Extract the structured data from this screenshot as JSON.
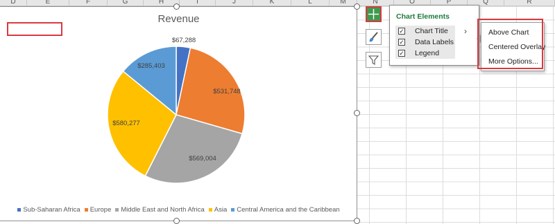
{
  "columns": [
    "D",
    "E",
    "F",
    "G",
    "H",
    "I",
    "J",
    "K",
    "L",
    "M",
    "N",
    "O",
    "P",
    "Q",
    "R"
  ],
  "chart": {
    "title": "Revenue",
    "data_labels": [
      "$67,288",
      "$531,748",
      "$569,004",
      "$580,277",
      "$285,403"
    ],
    "legend": [
      "Sub-Saharan Africa",
      "Europe",
      "Middle East and North Africa",
      "Asia",
      "Central America and the Caribbean"
    ]
  },
  "chart_data": {
    "type": "pie",
    "title": "Revenue",
    "categories": [
      "Sub-Saharan Africa",
      "Europe",
      "Middle East and North Africa",
      "Asia",
      "Central America and the Caribbean"
    ],
    "values": [
      67288,
      531748,
      569004,
      580277,
      285403
    ],
    "colors": [
      "#4472c4",
      "#ed7d31",
      "#a5a5a5",
      "#ffc000",
      "#5b9bd5"
    ],
    "legend_position": "bottom"
  },
  "side_buttons": [
    {
      "name": "chart-elements-icon"
    },
    {
      "name": "chart-styles-icon"
    },
    {
      "name": "chart-filters-icon"
    }
  ],
  "chart_elements_popup": {
    "heading": "Chart Elements",
    "items": [
      {
        "label": "Chart Title",
        "checked": true
      },
      {
        "label": "Data Labels",
        "checked": true
      },
      {
        "label": "Legend",
        "checked": true
      }
    ]
  },
  "chart_title_submenu": {
    "items": [
      "Above Chart",
      "Centered Overlay",
      "More Options..."
    ]
  }
}
